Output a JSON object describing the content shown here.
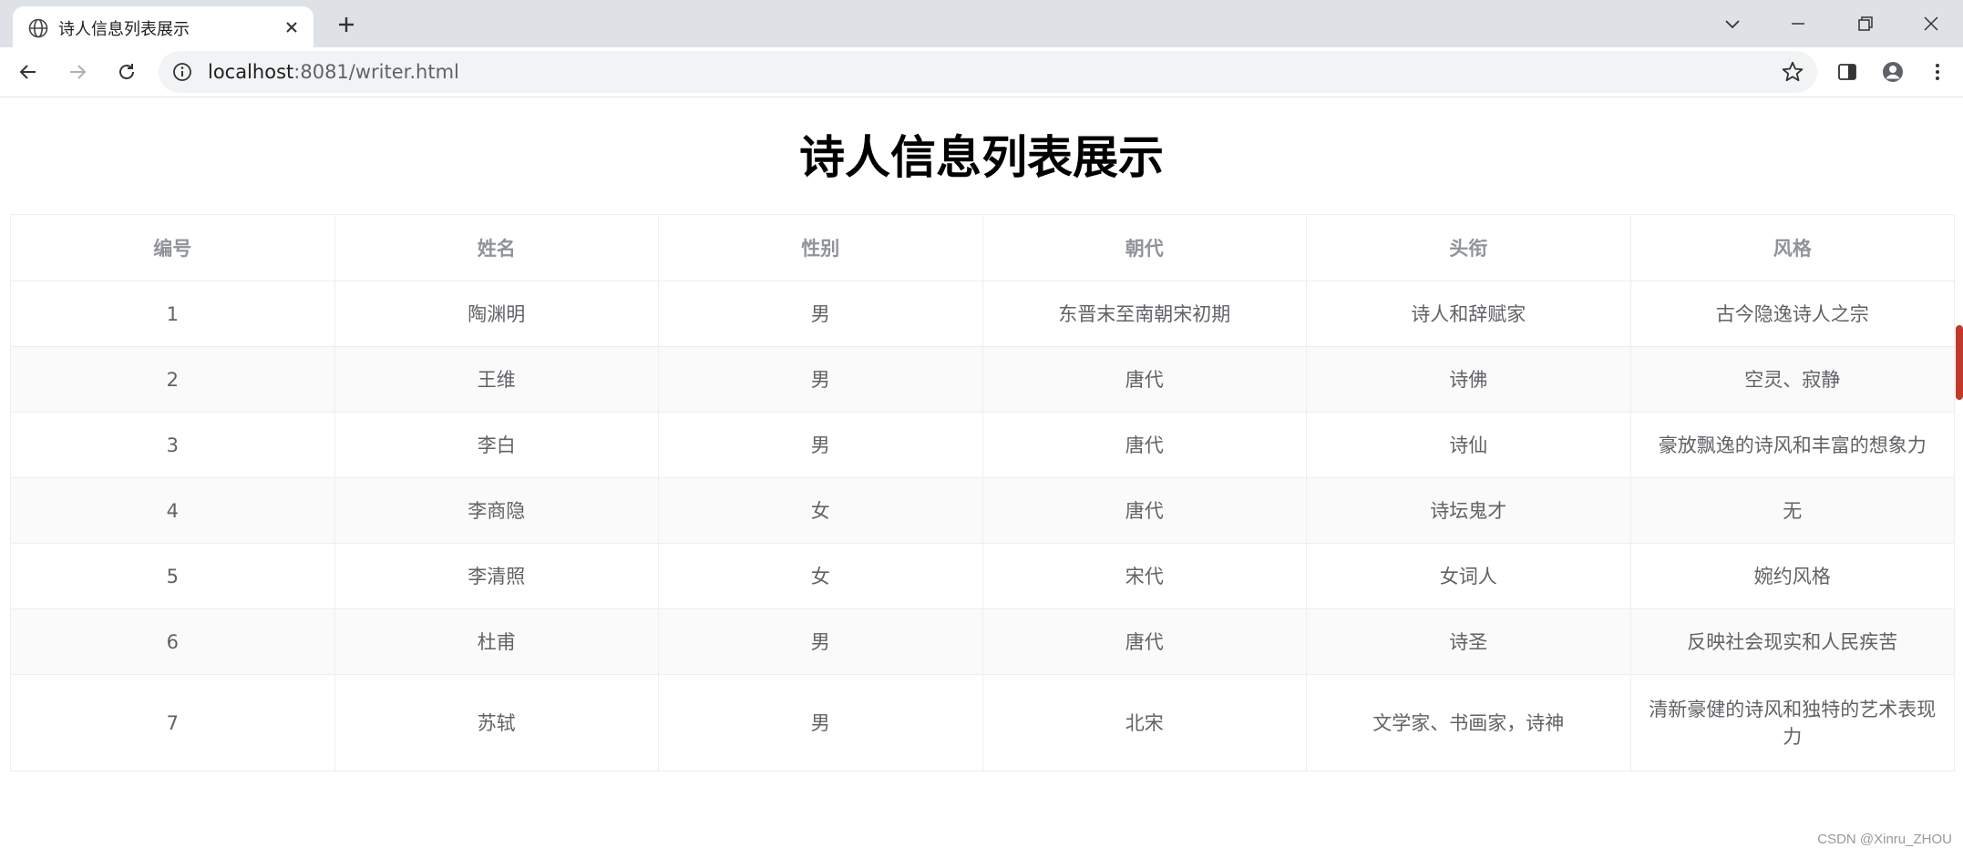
{
  "browser": {
    "tab_title": "诗人信息列表展示",
    "url_host": "localhost",
    "url_rest": ":8081/writer.html"
  },
  "page": {
    "title": "诗人信息列表展示"
  },
  "table": {
    "headers": [
      "编号",
      "姓名",
      "性别",
      "朝代",
      "头衔",
      "风格"
    ],
    "rows": [
      [
        "1",
        "陶渊明",
        "男",
        "东晋末至南朝宋初期",
        "诗人和辞赋家",
        "古今隐逸诗人之宗"
      ],
      [
        "2",
        "王维",
        "男",
        "唐代",
        "诗佛",
        "空灵、寂静"
      ],
      [
        "3",
        "李白",
        "男",
        "唐代",
        "诗仙",
        "豪放飘逸的诗风和丰富的想象力"
      ],
      [
        "4",
        "李商隐",
        "女",
        "唐代",
        "诗坛鬼才",
        "无"
      ],
      [
        "5",
        "李清照",
        "女",
        "宋代",
        "女词人",
        "婉约风格"
      ],
      [
        "6",
        "杜甫",
        "男",
        "唐代",
        "诗圣",
        "反映社会现实和人民疾苦"
      ],
      [
        "7",
        "苏轼",
        "男",
        "北宋",
        "文学家、书画家，诗神",
        "清新豪健的诗风和独特的艺术表现力"
      ]
    ]
  },
  "watermark": "CSDN @Xinru_ZHOU",
  "colors": {
    "header_text": "#909399",
    "cell_text": "#606266",
    "border": "#ebeef5",
    "stripe": "#fafafa"
  }
}
